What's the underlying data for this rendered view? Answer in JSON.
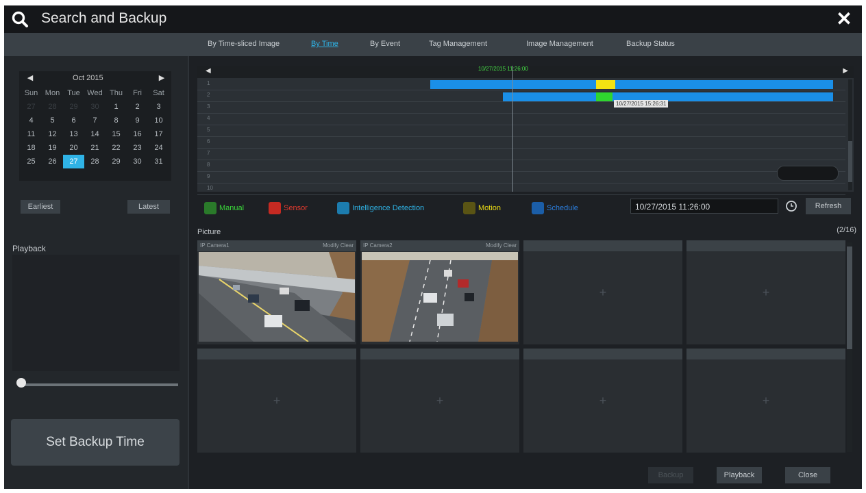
{
  "window": {
    "title": "Search and Backup"
  },
  "tabs": [
    {
      "label": "By Time-sliced Image"
    },
    {
      "label": "By Time"
    },
    {
      "label": "By Event"
    },
    {
      "label": "Tag Management"
    },
    {
      "label": "Image Management"
    },
    {
      "label": "Backup Status"
    }
  ],
  "calendar": {
    "month_label": "Oct  2015",
    "weekdays": [
      "Sun",
      "Mon",
      "Tue",
      "Wed",
      "Thu",
      "Fri",
      "Sat"
    ],
    "leading_blank": [
      "27",
      "28",
      "29",
      "30"
    ],
    "days": [
      "1",
      "2",
      "3",
      "4",
      "5",
      "6",
      "7",
      "8",
      "9",
      "10",
      "11",
      "12",
      "13",
      "14",
      "15",
      "16",
      "17",
      "18",
      "19",
      "20",
      "21",
      "22",
      "23",
      "24",
      "25",
      "26",
      "27",
      "28",
      "29",
      "30",
      "31"
    ],
    "selected_day": "27",
    "earliest_label": "Earliest",
    "latest_label": "Latest"
  },
  "playback_label": "Playback",
  "playback_progress": 0,
  "set_backup_label": "Set Backup Time",
  "timeline": {
    "current_time": "10/27/2015 11:26:00",
    "tooltip": "10/27/2015 15:26:31",
    "row_numbers": [
      "1",
      "2",
      "3",
      "4",
      "5",
      "6",
      "7",
      "8",
      "9",
      "10"
    ]
  },
  "legend": {
    "manual": "Manual",
    "sensor": "Sensor",
    "intelligence": "Intelligence Detection",
    "motion": "Motion",
    "schedule": "Schedule"
  },
  "datetime_value": "10/27/2015 11:26:00",
  "refresh_label": "Refresh",
  "picture_label": "Picture",
  "picture_count": "(2/16)",
  "cells": [
    {
      "camera": "IP Camera1",
      "actions": "Modify  Clear"
    },
    {
      "camera": "IP Camera2",
      "actions": "Modify  Clear"
    }
  ],
  "bottom": {
    "backup_label": "Backup",
    "playback_label": "Playback",
    "close_label": "Close"
  },
  "colors": {
    "accent": "#2fb3e6",
    "bar": "#1a8fe8",
    "yellow": "#f4e312",
    "green": "#2fd62f"
  }
}
